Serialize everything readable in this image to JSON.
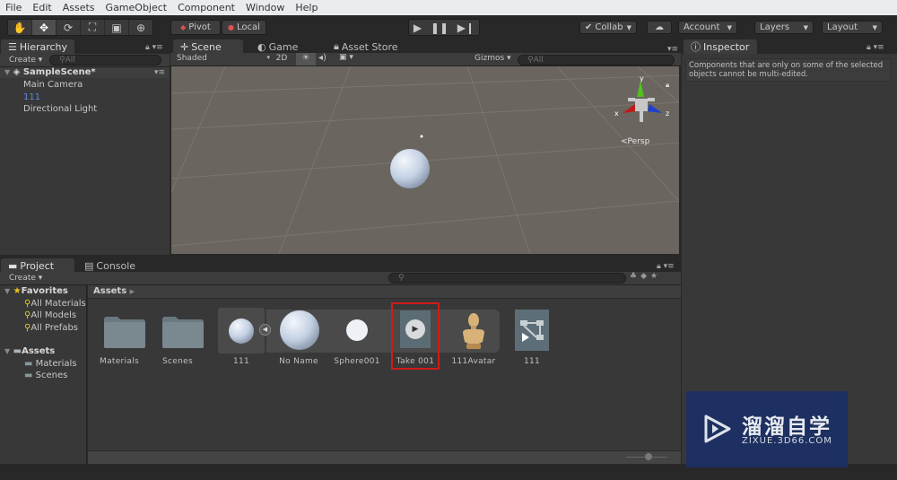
{
  "menu": [
    "File",
    "Edit",
    "Assets",
    "GameObject",
    "Component",
    "Window",
    "Help"
  ],
  "toolbar": {
    "tools": [
      "hand-tool",
      "move-tool",
      "rotate-tool",
      "scale-tool",
      "rect-tool",
      "transform-tool"
    ],
    "pivot_label": "Pivot",
    "local_label": "Local",
    "collab_label": "Collab",
    "account_label": "Account",
    "layers_label": "Layers",
    "layout_label": "Layout"
  },
  "hierarchy": {
    "tab_label": "Hierarchy",
    "create_label": "Create",
    "search_placeholder": "All",
    "scene_name": "SampleScene*",
    "items": [
      {
        "label": "Main Camera",
        "highlight": false
      },
      {
        "label": "111",
        "highlight": true
      },
      {
        "label": "Directional Light",
        "highlight": false
      }
    ]
  },
  "scene": {
    "tabs": [
      "Scene",
      "Game",
      "Asset Store"
    ],
    "shading_mode": "Shaded",
    "mode_2d_label": "2D",
    "gizmos_label": "Gizmos",
    "search_placeholder": "All",
    "persp_label": "Persp",
    "axis_labels": {
      "x": "x",
      "y": "y",
      "z": "z"
    },
    "axis_colors": {
      "x": "#c01c1c",
      "y": "#4fc21c",
      "z": "#1d3fd1"
    }
  },
  "inspector": {
    "tab_label": "Inspector",
    "message": "Components that are only on some of the selected objects cannot be multi-edited."
  },
  "project": {
    "tabs": [
      "Project",
      "Console"
    ],
    "create_label": "Create",
    "favorites_label": "Favorites",
    "favorites": [
      "All Materials",
      "All Models",
      "All Prefabs"
    ],
    "assets_label": "Assets",
    "asset_folders": [
      "Materials",
      "Scenes"
    ],
    "breadcrumb": "Assets",
    "items": [
      {
        "label": "Materials",
        "type": "folder"
      },
      {
        "label": "Scenes",
        "type": "folder"
      },
      {
        "label": "111",
        "type": "model"
      },
      {
        "label": "No Name",
        "type": "mesh"
      },
      {
        "label": "Sphere001",
        "type": "mesh"
      },
      {
        "label": "Take 001",
        "type": "animation-clip",
        "selected": true
      },
      {
        "label": "111Avatar",
        "type": "avatar"
      },
      {
        "label": "111",
        "type": "animator-controller"
      }
    ],
    "highlight_color": "#d11a1a"
  },
  "watermark": {
    "title": "溜溜自学",
    "url": "ZIXUE.3D66.COM",
    "bg_color": "#1d3061"
  }
}
